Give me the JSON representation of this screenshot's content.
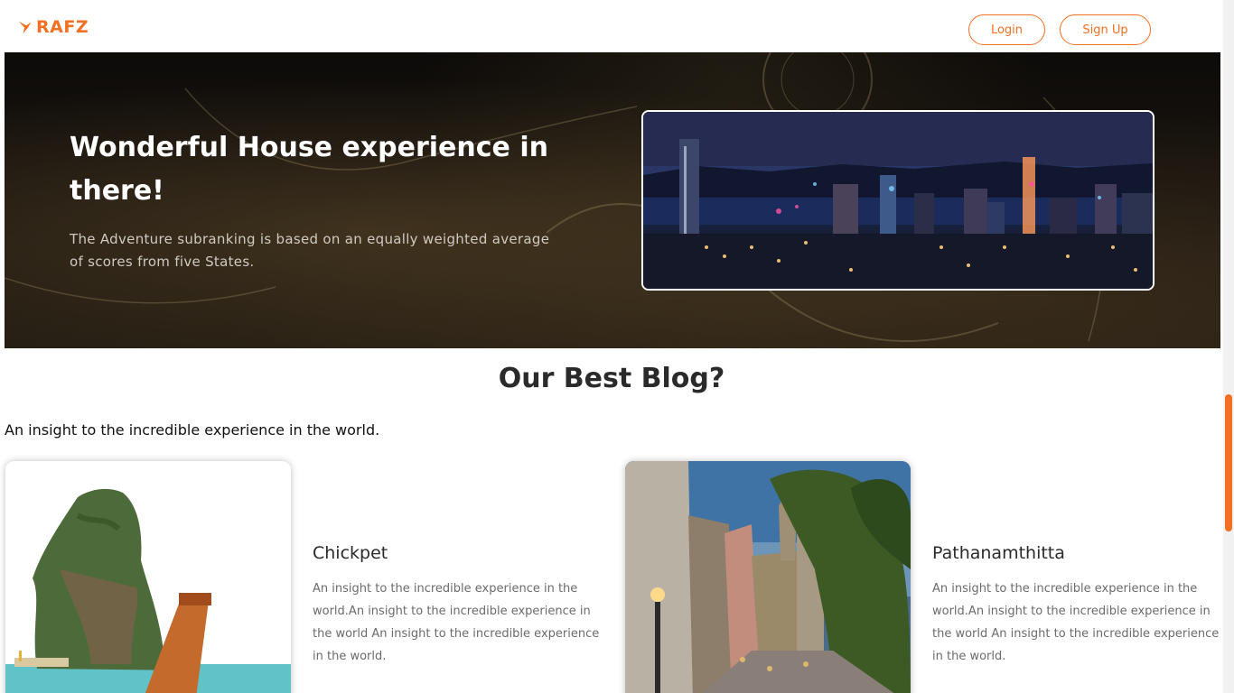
{
  "brand": {
    "name": "RAFZ",
    "accent_color": "#f36f21",
    "logo_icon": "bird-icon"
  },
  "nav": {
    "login_label": "Login",
    "signup_label": "Sign Up"
  },
  "hero": {
    "title": "Wonderful House experience in there!",
    "subtitle": "The Adventure subranking is based on an equally weighted average of scores from five States.",
    "image": "night-city-skyline-image"
  },
  "blog": {
    "title": "Our Best Blog?",
    "subtitle": "An insight to the incredible experience in the world.",
    "cards": [
      {
        "title": "Chickpet",
        "text": "An insight to the incredible experience in the world.An insight to the incredible experience in the world An insight to the incredible experience in the world.",
        "image": "island-longtail-boat-image"
      },
      {
        "title": "Pathanamthitta",
        "text": "An insight to the incredible experience in the world.An insight to the incredible experience in the world An insight to the incredible experience in the world.",
        "image": "old-town-street-image"
      }
    ]
  }
}
